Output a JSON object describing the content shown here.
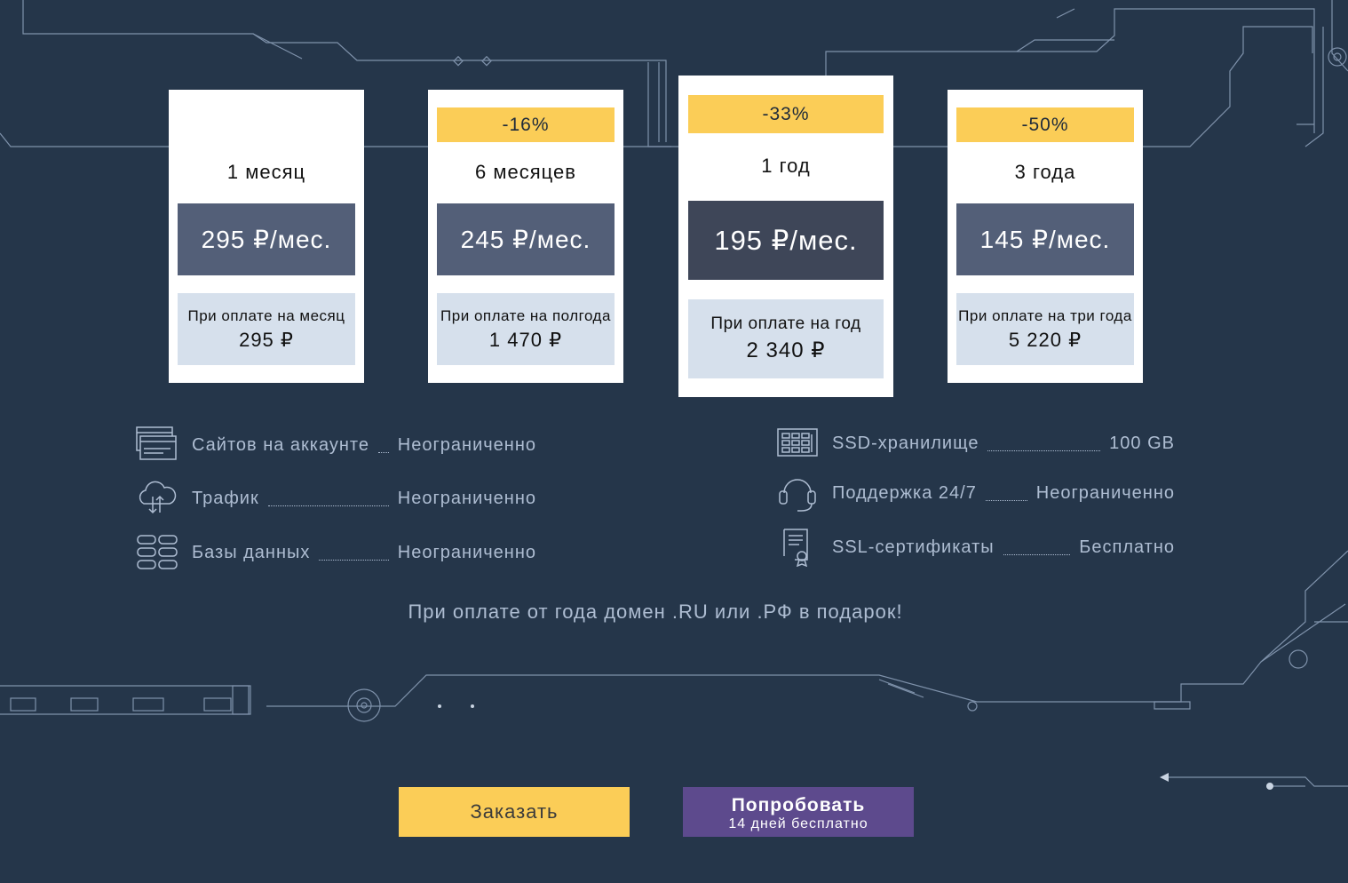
{
  "plans": [
    {
      "discount": "",
      "term": "1 месяц",
      "price": "295 ₽/мес.",
      "pay_label": "При оплате на месяц",
      "pay_total": "295 ₽"
    },
    {
      "discount": "-16%",
      "term": "6 месяцев",
      "price": "245 ₽/мес.",
      "pay_label": "При оплате на полгода",
      "pay_total": "1 470 ₽"
    },
    {
      "discount": "-33%",
      "term": "1 год",
      "price": "195 ₽/мес.",
      "pay_label": "При оплате на год",
      "pay_total": "2 340 ₽",
      "highlighted": true
    },
    {
      "discount": "-50%",
      "term": "3 года",
      "price": "145 ₽/мес.",
      "pay_label": "При оплате на три года",
      "pay_total": "5 220 ₽"
    }
  ],
  "features_left": [
    {
      "icon": "websites-icon",
      "label": "Сайтов на аккаунте",
      "value": "Неограниченно"
    },
    {
      "icon": "cloud-traffic-icon",
      "label": "Трафик",
      "value": "Неограниченно"
    },
    {
      "icon": "database-icon",
      "label": "Базы данных",
      "value": "Неограниченно"
    }
  ],
  "features_right": [
    {
      "icon": "ssd-icon",
      "label": "SSD-хранилище",
      "value": "100 GB"
    },
    {
      "icon": "headset-icon",
      "label": "Поддержка 24/7",
      "value": "Неограниченно"
    },
    {
      "icon": "certificate-icon",
      "label": "SSL-сертификаты",
      "value": "Бесплатно"
    }
  ],
  "promo": "При оплате от года домен .RU или .РФ в подарок!",
  "buttons": {
    "order_label": "Заказать",
    "try_label": "Попробовать",
    "try_sub": "14 дней бесплатно"
  },
  "colors": {
    "background": "#25364a",
    "accent_yellow": "#fbcd57",
    "price_box": "#535f78",
    "price_box_highlight": "#3e4658",
    "total_box": "#d6e0ec",
    "purple": "#5d4a8d",
    "line": "#8fa3bd"
  }
}
